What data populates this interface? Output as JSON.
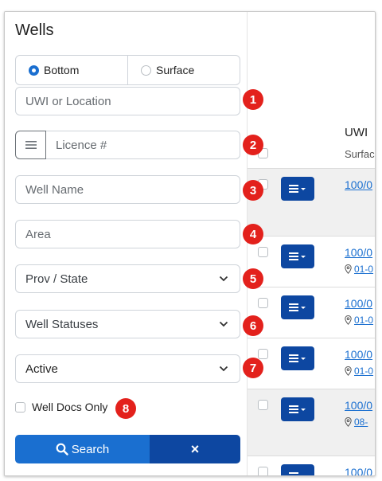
{
  "panel": {
    "title": "Wells",
    "location_type": {
      "options": [
        "Bottom",
        "Surface"
      ],
      "selected": "Bottom"
    },
    "uwi_placeholder": "UWI or Location",
    "licence_placeholder": "Licence #",
    "well_name_placeholder": "Well Name",
    "area_placeholder": "Area",
    "prov_state_value": "Prov / State",
    "well_statuses_value": "Well Statuses",
    "active_value": "Active",
    "well_docs_label": "Well Docs Only",
    "search_label": "Search",
    "clear_label": "×"
  },
  "badges": [
    "1",
    "2",
    "3",
    "4",
    "5",
    "6",
    "7",
    "8"
  ],
  "table": {
    "column_header": "UWI",
    "column_subheader": "Surface",
    "rows": [
      {
        "uwi": "100/0",
        "location": ""
      },
      {
        "uwi": "100/0",
        "location": "01-0"
      },
      {
        "uwi": "100/0",
        "location": "01-0"
      },
      {
        "uwi": "100/0",
        "location": "01-0"
      },
      {
        "uwi": "100/0",
        "location": "08-"
      },
      {
        "uwi": "100/0",
        "location": ""
      }
    ]
  },
  "colors": {
    "primary": "#1a6fd0",
    "dark_primary": "#0d47a1",
    "badge_red": "#e3211c"
  },
  "icons": [
    "radio-icon",
    "list-icon",
    "chevron-down-icon",
    "search-icon",
    "close-icon",
    "menu-caret-icon",
    "map-pin-icon"
  ]
}
